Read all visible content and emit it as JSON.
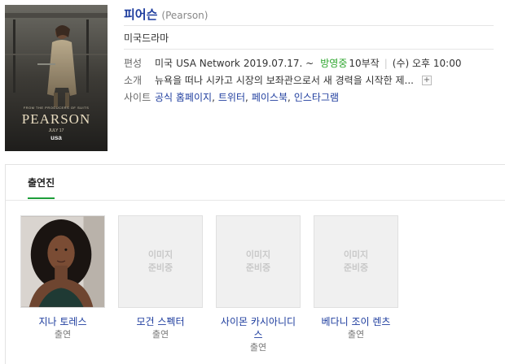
{
  "show": {
    "title": "피어슨",
    "original_title": "(Pearson)",
    "genre": "미국드라마"
  },
  "poster": {
    "title_text": "PEARSON",
    "date_text": "JULY 17",
    "network_text": "usa",
    "tagline_text": "FROM THE PRODUCERS OF SUITS"
  },
  "meta": {
    "schedule_label": "편성",
    "schedule_country": "미국",
    "schedule_network": "USA Network",
    "schedule_date": "2019.07.17. ~",
    "schedule_status": "방영중",
    "schedule_episodes": "10부작",
    "schedule_sep": "|",
    "schedule_time": "(수) 오후 10:00",
    "intro_label": "소개",
    "intro_text": "뉴욕을 떠나 시카고 시장의 보좌관으로서 새 경력을 시작한 제...",
    "intro_more": "+",
    "site_label": "사이트",
    "site_links": [
      "공식 홈페이지",
      "트위터",
      "페이스북",
      "인스타그램"
    ],
    "site_sep": ","
  },
  "cast_section": {
    "tab_label": "출연진",
    "placeholder_line1": "이미지",
    "placeholder_line2": "준비중",
    "members": [
      {
        "name": "지나 토레스",
        "role": "출연"
      },
      {
        "name": "모건 스펙터",
        "role": "출연"
      },
      {
        "name": "사이몬 카시아니디스",
        "role": "출연"
      },
      {
        "name": "베다니 조이 렌츠",
        "role": "출연"
      }
    ]
  },
  "colors": {
    "link": "#1e3d9e",
    "status_green": "#2ca52c",
    "tab_underline": "#1e9e3a"
  }
}
